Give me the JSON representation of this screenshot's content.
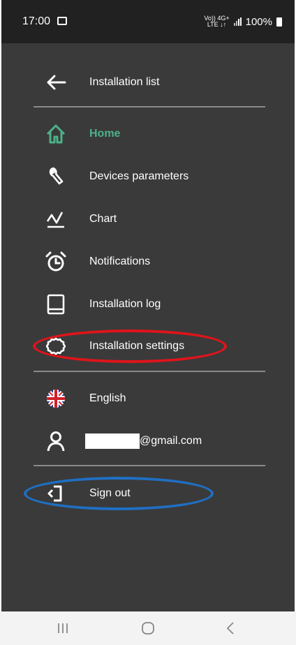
{
  "status_bar": {
    "time": "17:00",
    "network_top": "Vo)) 4G+",
    "network_bottom": "LTE ↓↑",
    "battery": "100%"
  },
  "menu": {
    "back": {
      "label": "Installation list",
      "icon": "arrow-left-icon"
    },
    "items": [
      {
        "label": "Home",
        "icon": "home-icon",
        "active": true
      },
      {
        "label": "Devices parameters",
        "icon": "wrench-icon"
      },
      {
        "label": "Chart",
        "icon": "chart-line-icon"
      },
      {
        "label": "Notifications",
        "icon": "alarm-clock-icon"
      },
      {
        "label": "Installation log",
        "icon": "book-icon"
      },
      {
        "label": "Installation settings",
        "icon": "gear-icon"
      }
    ],
    "language": {
      "label": "English",
      "icon": "uk-flag-icon"
    },
    "account": {
      "email_suffix": "@gmail.com",
      "icon": "user-icon"
    },
    "sign_out": {
      "label": "Sign out",
      "icon": "sign-out-icon"
    }
  },
  "annotations": {
    "red_highlight": "Installation settings",
    "blue_highlight": "Sign out",
    "red_color": "#e0141a",
    "blue_color": "#1f6fc2"
  },
  "colors": {
    "drawer_bg": "#3a3a3a",
    "accent": "#4db18a",
    "text": "#ffffff"
  },
  "nav_bar": {
    "recents": "recents-icon",
    "home": "home-circle-icon",
    "back": "back-chevron-icon"
  }
}
